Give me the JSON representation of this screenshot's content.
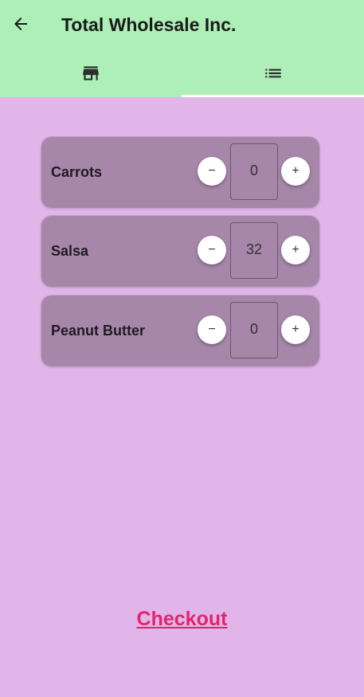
{
  "app_bar": {
    "title": "Total Wholesale Inc.",
    "back_icon": "arrow-back-icon",
    "background": "#adefb6"
  },
  "tabs": [
    {
      "icon": "store-icon",
      "selected": false
    },
    {
      "icon": "list-icon",
      "selected": true
    }
  ],
  "items": [
    {
      "name": "Carrots",
      "quantity": "0"
    },
    {
      "name": "Salsa",
      "quantity": "32"
    },
    {
      "name": "Peanut Butter",
      "quantity": "0"
    }
  ],
  "controls": {
    "minus_symbol": "−",
    "plus_symbol": "+"
  },
  "checkout_label": "Checkout",
  "colors": {
    "page_background": "#e2b5ea",
    "card_background": "#a687a9",
    "checkout_color": "#e3246c"
  }
}
